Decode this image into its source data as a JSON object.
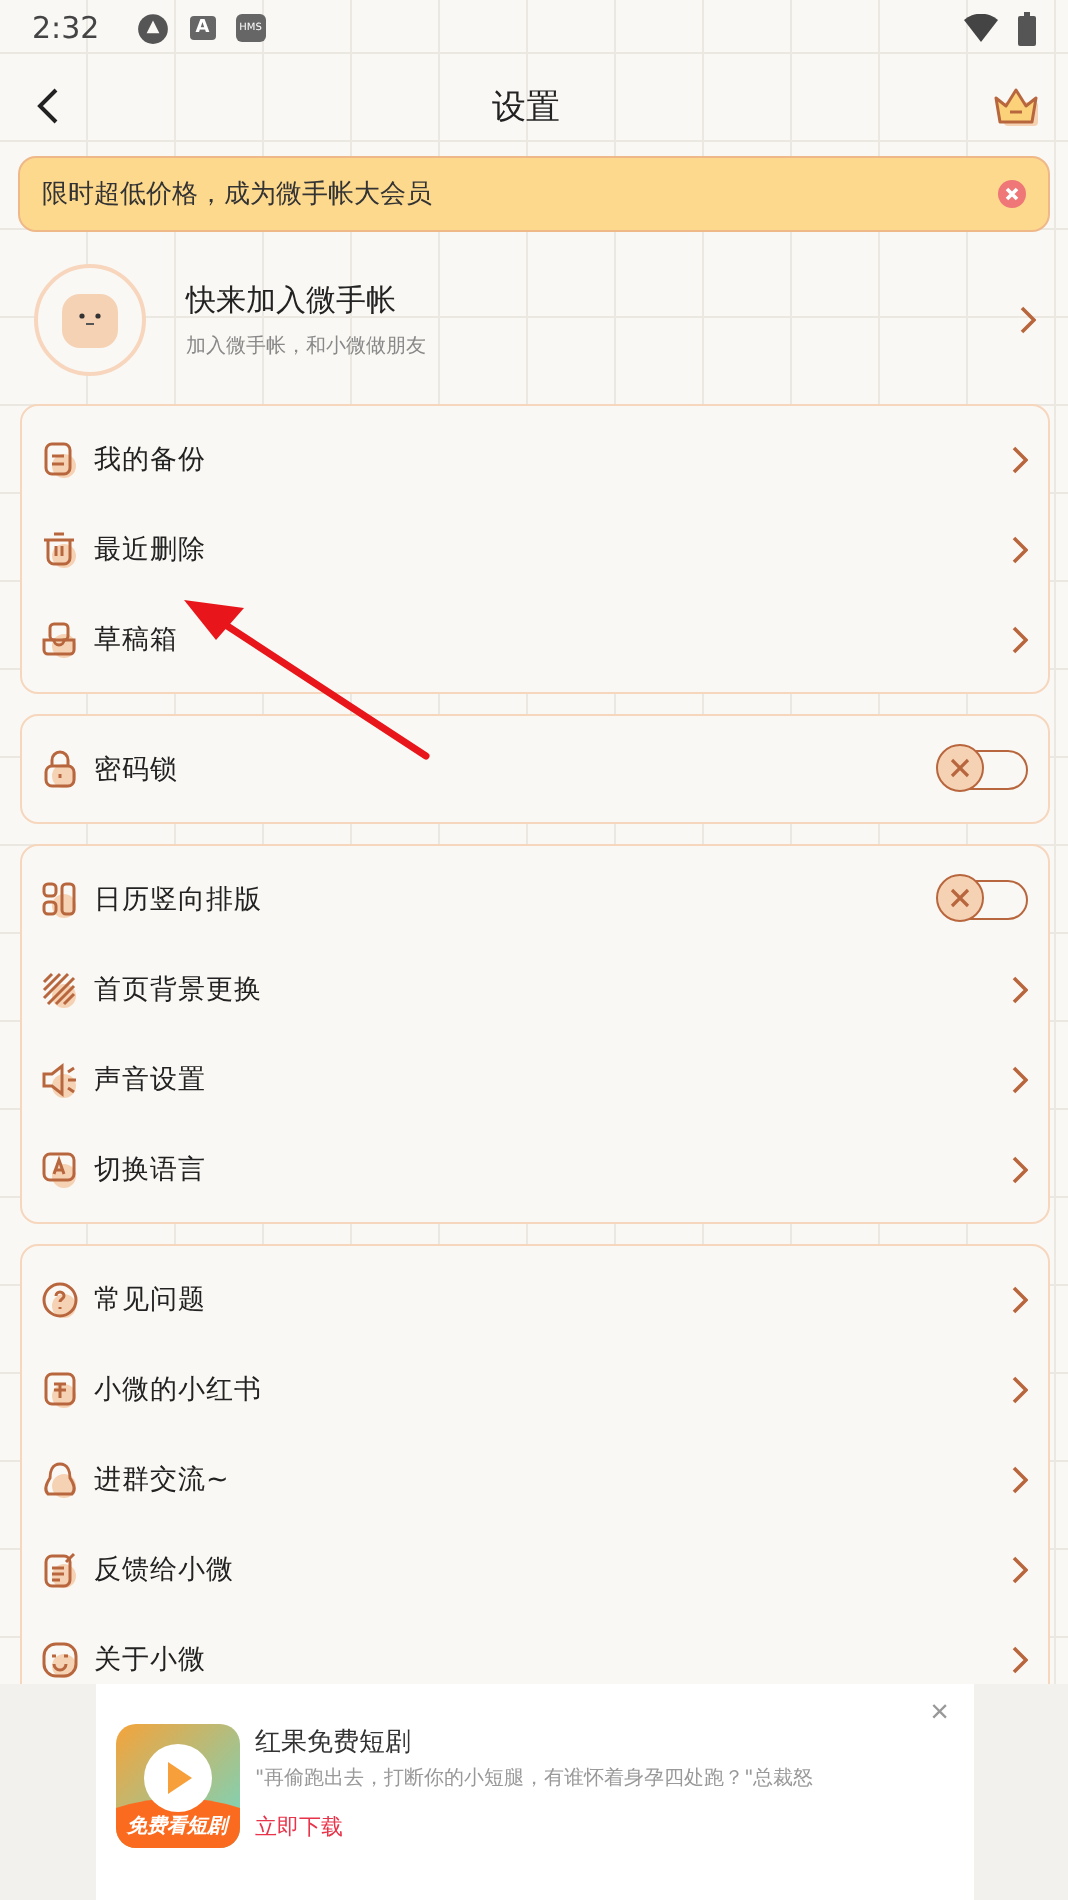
{
  "status_bar": {
    "time": "2:32",
    "badge": "A",
    "hms": "HMS"
  },
  "header": {
    "title": "设置"
  },
  "promo": {
    "text": "限时超低价格，成为微手帐大会员"
  },
  "profile": {
    "name": "快来加入微手帐",
    "subtitle": "加入微手帐，和小微做朋友"
  },
  "groups": [
    {
      "items": [
        {
          "kind": "link",
          "label": "我的备份"
        },
        {
          "kind": "link",
          "label": "最近删除"
        },
        {
          "kind": "link",
          "label": "草稿箱"
        }
      ]
    },
    {
      "items": [
        {
          "kind": "toggle",
          "label": "密码锁",
          "on": false
        }
      ]
    },
    {
      "items": [
        {
          "kind": "toggle",
          "label": "日历竖向排版",
          "on": false
        },
        {
          "kind": "link",
          "label": "首页背景更换"
        },
        {
          "kind": "link",
          "label": "声音设置"
        },
        {
          "kind": "link",
          "label": "切换语言"
        }
      ]
    },
    {
      "items": [
        {
          "kind": "link",
          "label": "常见问题"
        },
        {
          "kind": "link",
          "label": "小微的小红书"
        },
        {
          "kind": "link",
          "label": "进群交流~"
        },
        {
          "kind": "link",
          "label": "反馈给小微"
        },
        {
          "kind": "link",
          "label": "关于小微"
        }
      ]
    }
  ],
  "ad": {
    "icon_caption": "免费看短剧",
    "title": "红果免费短剧",
    "description": "\"再偷跑出去，打断你的小短腿，有谁怀着身孕四处跑？\"总裁怒",
    "action": "立即下载",
    "close": "×"
  }
}
